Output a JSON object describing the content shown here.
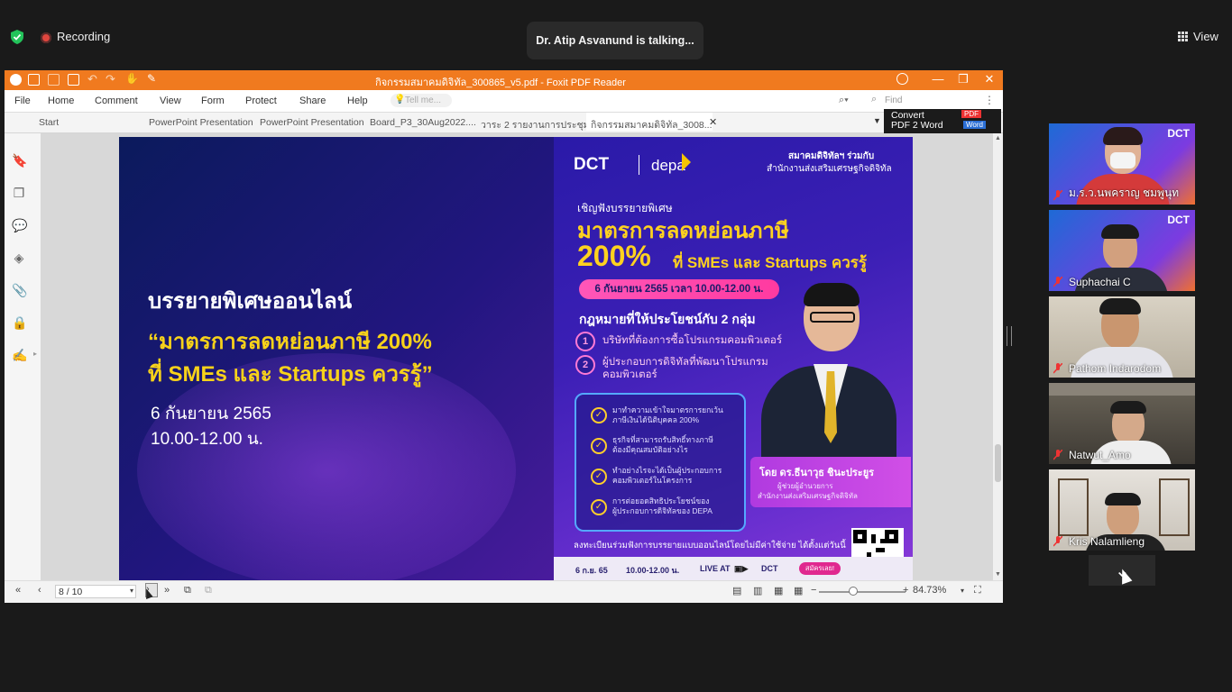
{
  "meeting": {
    "recording_label": "Recording",
    "talking_banner": "Dr. Atip Asvanund is talking...",
    "view_label": "View"
  },
  "app": {
    "window_title": "กิจกรรมสมาคมดิจิทัล_300865_v5.pdf - Foxit PDF Reader",
    "menu": [
      "File",
      "Home",
      "Comment",
      "View",
      "Form",
      "Protect",
      "Share",
      "Help"
    ],
    "tell_me_placeholder": "Tell me...",
    "find_placeholder": "Find",
    "tabs": [
      "Start",
      "PowerPoint Presentation",
      "PowerPoint Presentation",
      "Board_P3_30Aug2022....",
      "วาระ 2 รายงานการประชุม...",
      "กิจกรรมสมาคมดิจิทัล_3008..."
    ],
    "convert_label_1": "Convert",
    "convert_label_2": "PDF 2 Word",
    "convert_pdf_badge": "PDF",
    "convert_word_badge": "Word",
    "page_indicator": "8 / 10",
    "zoom": "84.73%",
    "accent_color": "#f07a1f"
  },
  "slide": {
    "heading": "บรรยายพิเศษออนไลน์",
    "quote_line1": "“มาตรการลดหย่อนภาษี 200%",
    "quote_line2": "ที่ SMEs  และ Startups ควรรู้”",
    "date": "6 กันยายน 2565",
    "time": "10.00-12.00 น."
  },
  "poster": {
    "logo_dct": "DCT",
    "logo_depa": "depa",
    "org_line1": "สมาคมดิจิทัลฯ ร่วมกับ",
    "org_line2": "สำนักงานส่งเสริมเศรษฐกิจดิจิทัล",
    "invite": "เชิญฟังบรรยายพิเศษ",
    "title1": "มาตรการลดหย่อนภาษี",
    "big": "200%",
    "title2": "ที่ SMEs และ Startups ควรรู้",
    "date_pill": "6 กันยายน 2565 เวลา 10.00-12.00 น.",
    "law_heading": "กฎหมายที่ให้ประโยชน์กับ 2 กลุ่ม",
    "law_items": [
      {
        "num": "1",
        "line1": "บริษัทที่ต้องการซื้อโปรแกรมคอมพิวเตอร์",
        "line2": ""
      },
      {
        "num": "2",
        "line1": "ผู้ประกอบการดิจิทัลที่พัฒนาโปรแกรม",
        "line2": "คอมพิวเตอร์"
      }
    ],
    "checks": [
      {
        "line1": "มาทำความเข้าใจมาตรการยกเว้น",
        "line2": "ภาษีเงินได้นิติบุคคล 200%"
      },
      {
        "line1": "ธุรกิจที่สามารถรับสิทธิ์ทางภาษี",
        "line2": "ต้องมีคุณสมบัติอย่างไร"
      },
      {
        "line1": "ทำอย่างไรจะได้เป็นผู้ประกอบการ",
        "line2": "คอมพิวเตอร์ในโครงการ"
      },
      {
        "line1": "การต่อยอดสิทธิประโยชน์ของ",
        "line2": "ผู้ประกอบการดิจิทัลของ DEPA"
      }
    ],
    "speaker_name": "โดย ดร.ธีนาวุธ ชินะประยูร",
    "speaker_role1": "ผู้ช่วยผู้อำนวยการ",
    "speaker_role2": "สำนักงานส่งเสริมเศรษฐกิจดิจิทัล",
    "register_note": "ลงทะเบียนร่วมฟังการบรรยายแบบออนไลน์โดยไม่มีค่าใช้จ่าย  ได้ตั้งแต่วันนี้",
    "bottom_date": "6 ก.ย. 65",
    "bottom_time": "10.00-12.00 น.",
    "bottom_live": "LIVE AT",
    "bottom_channel": "DCT",
    "register_button": "สมัครเลย!"
  },
  "participants": [
    {
      "name": "ม.ร.ว.นพคราญ ชมพูนุท",
      "banner": "DCT"
    },
    {
      "name": "Suphachai C",
      "banner": "DCT"
    },
    {
      "name": "Pathom Indarodom",
      "banner": ""
    },
    {
      "name": "Natwut_Amo",
      "banner": ""
    },
    {
      "name": "Kris Nalamlieng",
      "banner": ""
    }
  ]
}
